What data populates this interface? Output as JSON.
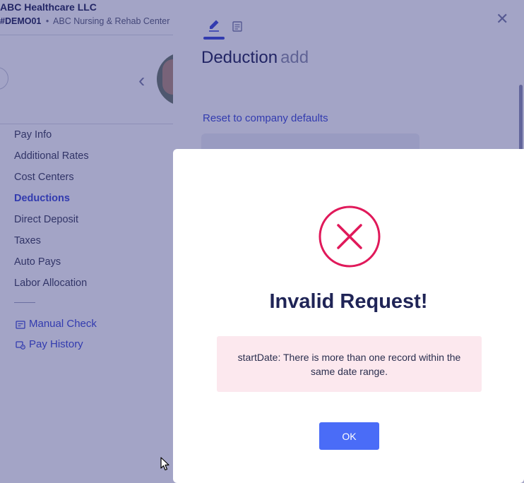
{
  "company": {
    "name": "ABC Healthcare LLC",
    "code": "#DEMO01",
    "separator": "•",
    "location": "ABC Nursing & Rehab Center"
  },
  "side_nav": {
    "items": [
      {
        "label": "Pay Info",
        "active": false
      },
      {
        "label": "Additional Rates",
        "active": false
      },
      {
        "label": "Cost Centers",
        "active": false
      },
      {
        "label": "Deductions",
        "active": true
      },
      {
        "label": "Direct Deposit",
        "active": false
      },
      {
        "label": "Taxes",
        "active": false
      },
      {
        "label": "Auto Pays",
        "active": false
      },
      {
        "label": "Labor Allocation",
        "active": false
      }
    ],
    "links": [
      {
        "label": "Manual Check",
        "icon": "check-icon"
      },
      {
        "label": "Pay History",
        "icon": "history-icon"
      }
    ]
  },
  "drawer": {
    "title": "Deduction",
    "title_suffix": "add",
    "reset_link": "Reset to company defaults",
    "tabs": [
      {
        "icon": "pencil-icon",
        "active": true
      },
      {
        "icon": "document-icon",
        "active": false
      }
    ],
    "close_icon": "close-icon"
  },
  "modal": {
    "icon": "error-x-icon",
    "title": "Invalid Request!",
    "message": "startDate: There is more than one record within the same date range.",
    "ok_label": "OK"
  },
  "colors": {
    "accent": "#3d4bd8",
    "button": "#4a6cf7",
    "error": "#e0195a",
    "error_bg": "#fce8ee",
    "overlay": "#23267a",
    "heading": "#1f2456"
  }
}
